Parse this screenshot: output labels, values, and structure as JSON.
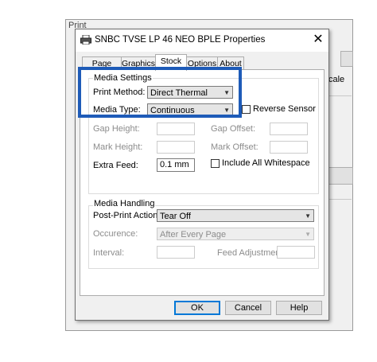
{
  "background_window": {
    "title": "Print",
    "scale_fragment": "cale"
  },
  "dialog": {
    "title": "SNBC TVSE LP 46 NEO BPLE Properties",
    "close_glyph": "✕",
    "tabs": [
      "Page Setup",
      "Graphics",
      "Stock",
      "Options",
      "About"
    ],
    "active_tab": "Stock"
  },
  "media_settings": {
    "group_label": "Media Settings",
    "print_method_label": "Print Method:",
    "print_method_value": "Direct Thermal",
    "media_type_label": "Media Type:",
    "media_type_value": "Continuous",
    "reverse_sensor_label": "Reverse Sensor",
    "gap_height_label": "Gap Height:",
    "gap_offset_label": "Gap Offset:",
    "mark_height_label": "Mark Height:",
    "mark_offset_label": "Mark Offset:",
    "extra_feed_label": "Extra Feed:",
    "extra_feed_value": "0.1 mm",
    "include_whitespace_label": "Include All Whitespace"
  },
  "media_handling": {
    "group_label": "Media Handling",
    "post_print_label": "Post-Print Action:",
    "post_print_value": "Tear Off",
    "occurrence_label": "Occurence:",
    "occurrence_value": "After Every Page",
    "interval_label": "Interval:",
    "feed_adjustment_label": "Feed Adjustment:"
  },
  "buttons": {
    "ok": "OK",
    "cancel": "Cancel",
    "help": "Help"
  },
  "colors": {
    "highlight": "#1e5bb8",
    "focus": "#0078d7"
  }
}
